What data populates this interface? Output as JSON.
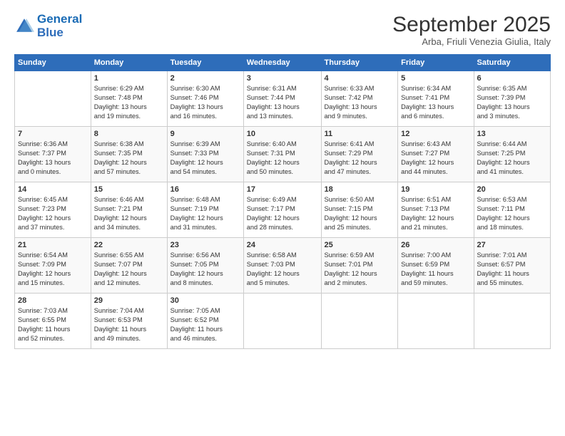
{
  "logo": {
    "line1": "General",
    "line2": "Blue"
  },
  "title": "September 2025",
  "subtitle": "Arba, Friuli Venezia Giulia, Italy",
  "weekdays": [
    "Sunday",
    "Monday",
    "Tuesday",
    "Wednesday",
    "Thursday",
    "Friday",
    "Saturday"
  ],
  "weeks": [
    [
      {
        "day": "",
        "info": ""
      },
      {
        "day": "1",
        "info": "Sunrise: 6:29 AM\nSunset: 7:48 PM\nDaylight: 13 hours\nand 19 minutes."
      },
      {
        "day": "2",
        "info": "Sunrise: 6:30 AM\nSunset: 7:46 PM\nDaylight: 13 hours\nand 16 minutes."
      },
      {
        "day": "3",
        "info": "Sunrise: 6:31 AM\nSunset: 7:44 PM\nDaylight: 13 hours\nand 13 minutes."
      },
      {
        "day": "4",
        "info": "Sunrise: 6:33 AM\nSunset: 7:42 PM\nDaylight: 13 hours\nand 9 minutes."
      },
      {
        "day": "5",
        "info": "Sunrise: 6:34 AM\nSunset: 7:41 PM\nDaylight: 13 hours\nand 6 minutes."
      },
      {
        "day": "6",
        "info": "Sunrise: 6:35 AM\nSunset: 7:39 PM\nDaylight: 13 hours\nand 3 minutes."
      }
    ],
    [
      {
        "day": "7",
        "info": "Sunrise: 6:36 AM\nSunset: 7:37 PM\nDaylight: 13 hours\nand 0 minutes."
      },
      {
        "day": "8",
        "info": "Sunrise: 6:38 AM\nSunset: 7:35 PM\nDaylight: 12 hours\nand 57 minutes."
      },
      {
        "day": "9",
        "info": "Sunrise: 6:39 AM\nSunset: 7:33 PM\nDaylight: 12 hours\nand 54 minutes."
      },
      {
        "day": "10",
        "info": "Sunrise: 6:40 AM\nSunset: 7:31 PM\nDaylight: 12 hours\nand 50 minutes."
      },
      {
        "day": "11",
        "info": "Sunrise: 6:41 AM\nSunset: 7:29 PM\nDaylight: 12 hours\nand 47 minutes."
      },
      {
        "day": "12",
        "info": "Sunrise: 6:43 AM\nSunset: 7:27 PM\nDaylight: 12 hours\nand 44 minutes."
      },
      {
        "day": "13",
        "info": "Sunrise: 6:44 AM\nSunset: 7:25 PM\nDaylight: 12 hours\nand 41 minutes."
      }
    ],
    [
      {
        "day": "14",
        "info": "Sunrise: 6:45 AM\nSunset: 7:23 PM\nDaylight: 12 hours\nand 37 minutes."
      },
      {
        "day": "15",
        "info": "Sunrise: 6:46 AM\nSunset: 7:21 PM\nDaylight: 12 hours\nand 34 minutes."
      },
      {
        "day": "16",
        "info": "Sunrise: 6:48 AM\nSunset: 7:19 PM\nDaylight: 12 hours\nand 31 minutes."
      },
      {
        "day": "17",
        "info": "Sunrise: 6:49 AM\nSunset: 7:17 PM\nDaylight: 12 hours\nand 28 minutes."
      },
      {
        "day": "18",
        "info": "Sunrise: 6:50 AM\nSunset: 7:15 PM\nDaylight: 12 hours\nand 25 minutes."
      },
      {
        "day": "19",
        "info": "Sunrise: 6:51 AM\nSunset: 7:13 PM\nDaylight: 12 hours\nand 21 minutes."
      },
      {
        "day": "20",
        "info": "Sunrise: 6:53 AM\nSunset: 7:11 PM\nDaylight: 12 hours\nand 18 minutes."
      }
    ],
    [
      {
        "day": "21",
        "info": "Sunrise: 6:54 AM\nSunset: 7:09 PM\nDaylight: 12 hours\nand 15 minutes."
      },
      {
        "day": "22",
        "info": "Sunrise: 6:55 AM\nSunset: 7:07 PM\nDaylight: 12 hours\nand 12 minutes."
      },
      {
        "day": "23",
        "info": "Sunrise: 6:56 AM\nSunset: 7:05 PM\nDaylight: 12 hours\nand 8 minutes."
      },
      {
        "day": "24",
        "info": "Sunrise: 6:58 AM\nSunset: 7:03 PM\nDaylight: 12 hours\nand 5 minutes."
      },
      {
        "day": "25",
        "info": "Sunrise: 6:59 AM\nSunset: 7:01 PM\nDaylight: 12 hours\nand 2 minutes."
      },
      {
        "day": "26",
        "info": "Sunrise: 7:00 AM\nSunset: 6:59 PM\nDaylight: 11 hours\nand 59 minutes."
      },
      {
        "day": "27",
        "info": "Sunrise: 7:01 AM\nSunset: 6:57 PM\nDaylight: 11 hours\nand 55 minutes."
      }
    ],
    [
      {
        "day": "28",
        "info": "Sunrise: 7:03 AM\nSunset: 6:55 PM\nDaylight: 11 hours\nand 52 minutes."
      },
      {
        "day": "29",
        "info": "Sunrise: 7:04 AM\nSunset: 6:53 PM\nDaylight: 11 hours\nand 49 minutes."
      },
      {
        "day": "30",
        "info": "Sunrise: 7:05 AM\nSunset: 6:52 PM\nDaylight: 11 hours\nand 46 minutes."
      },
      {
        "day": "",
        "info": ""
      },
      {
        "day": "",
        "info": ""
      },
      {
        "day": "",
        "info": ""
      },
      {
        "day": "",
        "info": ""
      }
    ]
  ]
}
